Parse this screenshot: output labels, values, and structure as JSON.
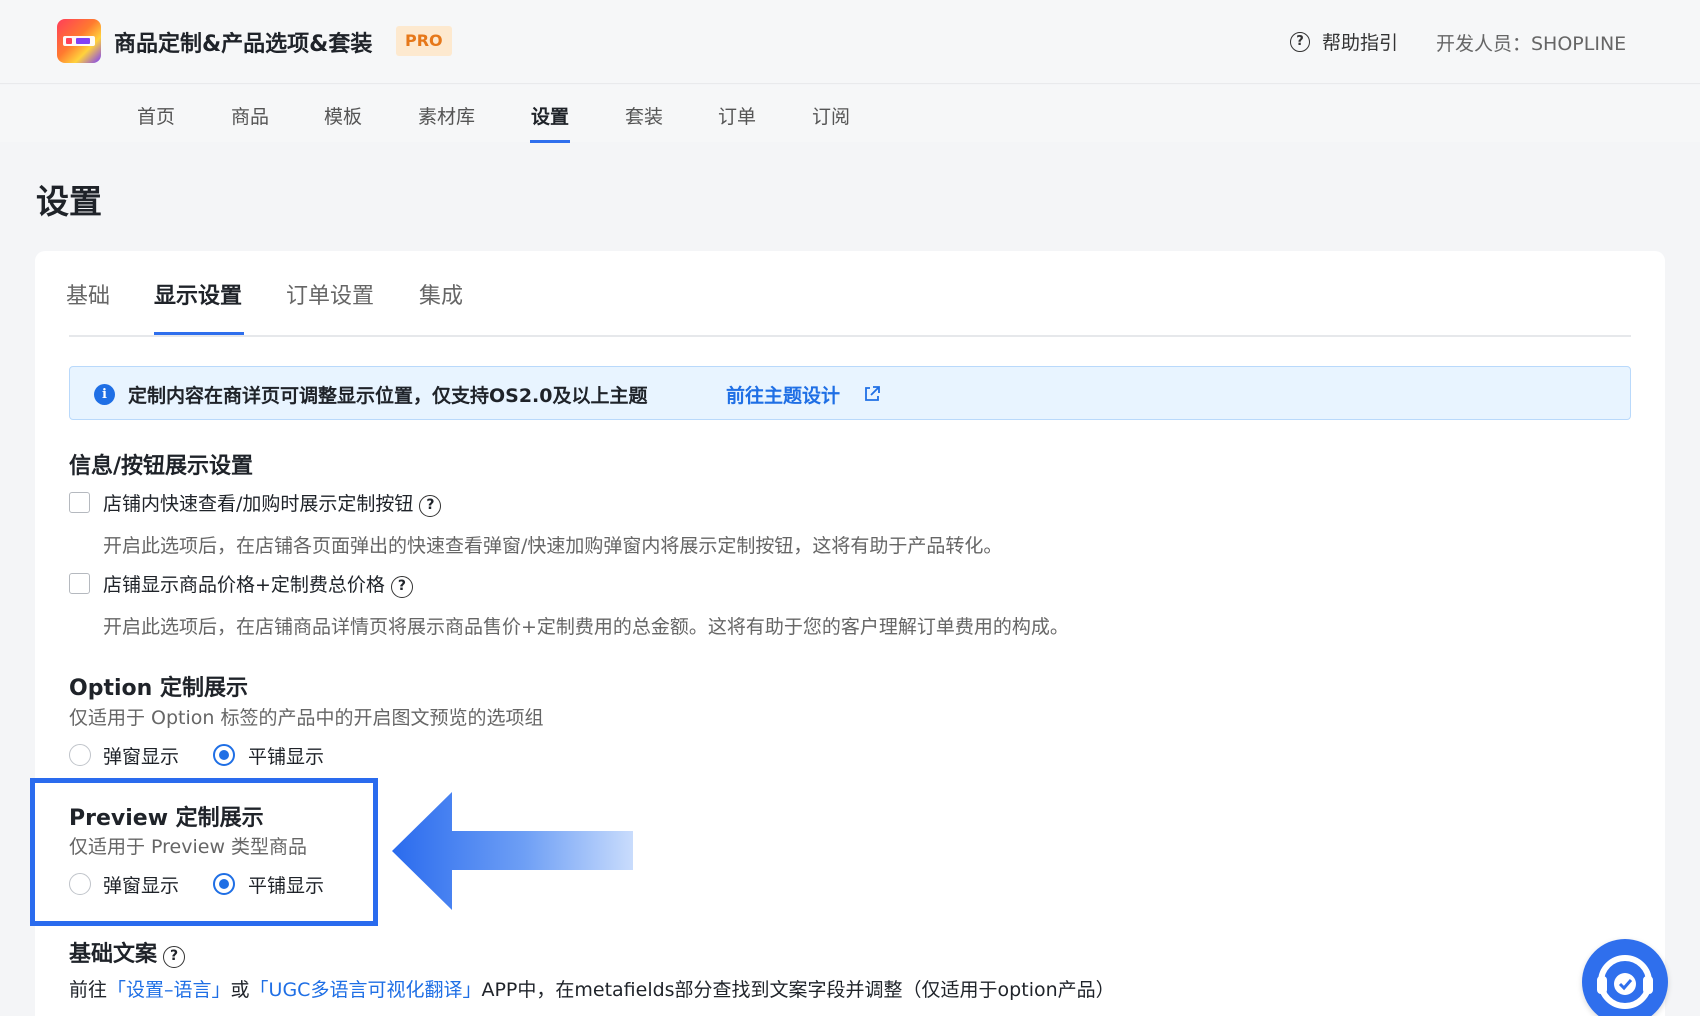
{
  "header": {
    "app_title": "商品定制&产品选项&套装",
    "badge": "PRO",
    "help_label": "帮助指引",
    "developer": "开发人员：SHOPLINE"
  },
  "nav": {
    "items": [
      "首页",
      "商品",
      "模板",
      "素材库",
      "设置",
      "套装",
      "订单",
      "订阅"
    ],
    "active": "设置"
  },
  "page_title": "设置",
  "tabs": {
    "items": [
      "基础",
      "显示设置",
      "订单设置",
      "集成"
    ],
    "active": "显示设置"
  },
  "alert": {
    "message": "定制内容在商详页可调整显示位置，仅支持OS2.0及以上主题",
    "link": "前往主题设计"
  },
  "info_section": {
    "title": "信息/按钮展示设置",
    "options": [
      {
        "label": "店铺内快速查看/加购时展示定制按钮",
        "checked": false,
        "description": "开启此选项后，在店铺各页面弹出的快速查看弹窗/快速加购弹窗内将展示定制按钮，这将有助于产品转化。"
      },
      {
        "label": "店铺显示商品价格+定制费总价格",
        "checked": false,
        "description": "开启此选项后，在店铺商品详情页将展示商品售价+定制费用的总金额。这将有助于您的客户理解订单费用的构成。"
      }
    ]
  },
  "option_section": {
    "title": "Option 定制展示",
    "subtitle": "仅适用于 Option 标签的产品中的开启图文预览的选项组",
    "radios": [
      "弹窗显示",
      "平铺显示"
    ],
    "selected": "平铺显示"
  },
  "preview_section": {
    "title": "Preview 定制展示",
    "subtitle": "仅适用于 Preview 类型商品",
    "radios": [
      "弹窗显示",
      "平铺显示"
    ],
    "selected": "平铺显示"
  },
  "copy_section": {
    "title": "基础文案",
    "prefix": "前往",
    "link1": "「设置–语言」",
    "mid": "或",
    "link2": "「UGC多语言可视化翻译」",
    "suffix": "APP中，在metafields部分查找到文案字段并调整（仅适用于option产品）"
  },
  "colors": {
    "accent": "#1f6fe5",
    "highlight": "#2a6bee",
    "badge_bg": "#fde9cf",
    "badge_text": "#e6781a"
  }
}
